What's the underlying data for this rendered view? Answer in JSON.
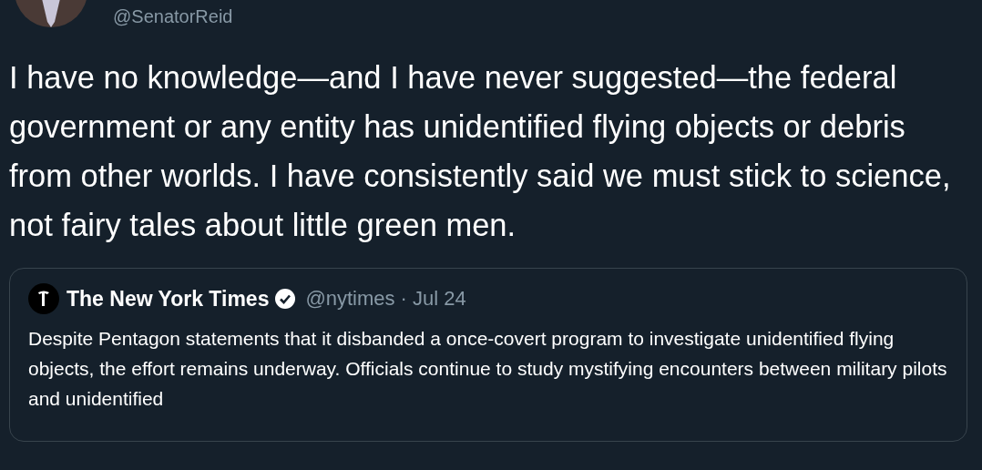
{
  "tweet": {
    "handle": "@SenatorReid",
    "text": "I have no knowledge—and I have never suggested—the federal government or any entity has unidentified flying objects or debris from other worlds. I have consistently said we must stick to science, not fairy tales about little green men.",
    "quoted_tweet": {
      "author": "The New York Times",
      "verified": true,
      "handle": "@nytimes",
      "date": "· Jul 24",
      "text": "Despite Pentagon statements that it disbanded a once-covert program to investigate unidentified flying objects, the effort remains underway. Officials continue to study mystifying encounters between military pilots and unidentified"
    }
  }
}
